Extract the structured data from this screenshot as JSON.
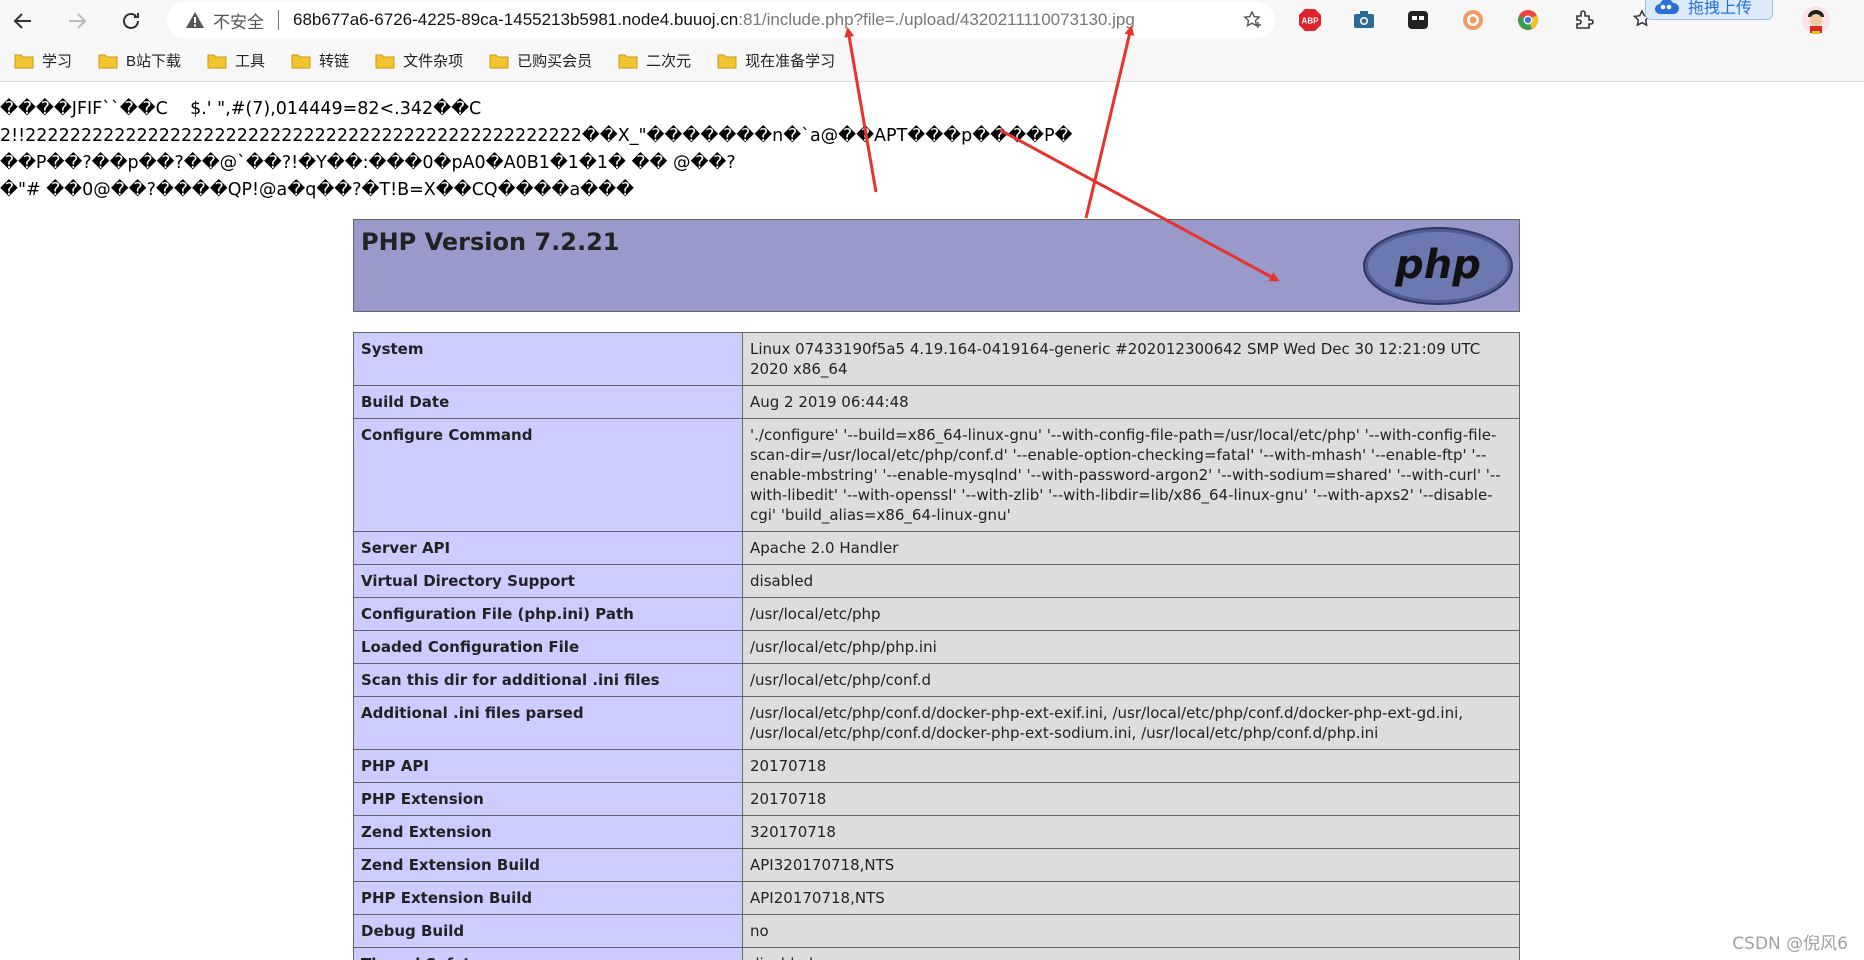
{
  "browser": {
    "security_label": "不安全",
    "url_host": "68b677a6-6726-4225-89ca-1455213b5981.node4.buuoj.cn",
    "url_rest": ":81/include.php?file=./upload/4320211110073130.jpg",
    "upload_chip_label": "拖拽上传",
    "icons": [
      "back-icon",
      "forward-icon",
      "reload-icon",
      "warning-icon",
      "favorite-icon",
      "abp-icon",
      "camera-icon",
      "extension-icon",
      "extension-icon",
      "extension-icon",
      "puzzle-icon",
      "favorites-icon",
      "avatar-icon"
    ]
  },
  "bookmarks": [
    {
      "label": "学习"
    },
    {
      "label": "B站下载"
    },
    {
      "label": "工具"
    },
    {
      "label": "转链"
    },
    {
      "label": "文件杂项"
    },
    {
      "label": "已购买会员"
    },
    {
      "label": "二次元"
    },
    {
      "label": "现在准备学习"
    }
  ],
  "garbage_lines": [
    "����\u0010JFIF\u0001\u0001\u0001``��C\u0002\u0002\u0002\u0002\u0002\u0002\u0002\u0002\u0002\u0002\u0002\u0002\u0002\u0002\u0002 \u0002 \u0002\u0002 \u0002\u0002\u0002\u0002\u0002\u0002\u0002\u0002\u0002\u0002\u0002\u0002\u0002\u0002\u0002\u0002\u0002\u0002 $.' \",#\u0001\u0001(7),01444\u00019=82<.342��C\u0001 \u0002\u0002\u0002\u0002\u0002",
    "\u00012!\u0001!22222222222222222222222222222222222222222222222222��\u0001\u0001X_\u0001\u0001\"\u0001\u0001\u0001\u0001\u0001\u0001\u0001��\u0001\u0001\u0001\u0001\u0001\u0001\u0001��\u0001\u0001\u0001\u0001\u0001\u0001\u0001\u0001\u0001\u0001\u0001\u0001��\u0001\u0001\u0001\u0001\u0001\u0001\u0001\u0001\u0001\u0001\u0001�n�`\u0001a@��APT�\u0001\u0001\u0001\u0001��\u0001\u0001\u0001\u0001p��\u0001\u0001\u0001\u0001\u0001\u0001\u0001\u0001\u0001\u0001��\u0001\u0001\u0001\u0001P�",
    "��\u0001\u0001\u0001\u0001P��\u0001\u0001\u0001\u0001\u0001\u0001?\u0001\u0001��\u0001\u0001\u0001\u0001\u0001p��\u0001\u0001\u0001\u0001\u0001?\u0001\u0001��\u0001\u0001\u0001\u0001\u0001\u0001\u0001\u0001@`��\u0001\u0001\u0001\u0001\u0001?!�Y��:���\u0001\u0001\u0001\u0001\u0001\u0001\u0001\u00010�\u0001pA\u00010�\u0001\u0001A\u00010B\u00011�1�1�\u0001\u0001 ��\u0001\u0001\u0001\u0001\u0001\u0001\u0001\u0001 @��\u0001\u0001\u0001\u0001\u0001\u0001?\u0001",
    "�\"# ��\u0001\u0001\u0001\u0001\u0001\u00010@��\u0001\u0001\u0001\u0001\u0001\u0001?\u0001����\u0001\u0001\u0001\u0001\u0001\u0001\u0001\u0001\u0001\u0001\u0001\u0001\u0001\u0001QP\u0001!@a�q��\u0001\u0001\u0001\u0001\u0001?\u0001�\u0001\u0001\u0001\u0001T!\u0001B=\u0001X��CQ��\u0001��a���"
  ],
  "phpinfo": {
    "version_title": "PHP Version 7.2.21",
    "logo_text": "php",
    "rows": [
      {
        "key": "System",
        "value": "Linux 07433190f5a5 4.19.164-0419164-generic #202012300642 SMP Wed Dec 30 12:21:09 UTC 2020 x86_64"
      },
      {
        "key": "Build Date",
        "value": "Aug 2 2019 06:44:48"
      },
      {
        "key": "Configure Command",
        "value": "'./configure' '--build=x86_64-linux-gnu' '--with-config-file-path=/usr/local/etc/php' '--with-config-file-scan-dir=/usr/local/etc/php/conf.d' '--enable-option-checking=fatal' '--with-mhash' '--enable-ftp' '--enable-mbstring' '--enable-mysqlnd' '--with-password-argon2' '--with-sodium=shared' '--with-curl' '--with-libedit' '--with-openssl' '--with-zlib' '--with-libdir=lib/x86_64-linux-gnu' '--with-apxs2' '--disable-cgi' 'build_alias=x86_64-linux-gnu'"
      },
      {
        "key": "Server API",
        "value": "Apache 2.0 Handler"
      },
      {
        "key": "Virtual Directory Support",
        "value": "disabled"
      },
      {
        "key": "Configuration File (php.ini) Path",
        "value": "/usr/local/etc/php"
      },
      {
        "key": "Loaded Configuration File",
        "value": "/usr/local/etc/php/php.ini"
      },
      {
        "key": "Scan this dir for additional .ini files",
        "value": "/usr/local/etc/php/conf.d"
      },
      {
        "key": "Additional .ini files parsed",
        "value": "/usr/local/etc/php/conf.d/docker-php-ext-exif.ini, /usr/local/etc/php/conf.d/docker-php-ext-gd.ini, /usr/local/etc/php/conf.d/docker-php-ext-sodium.ini, /usr/local/etc/php/conf.d/php.ini"
      },
      {
        "key": "PHP API",
        "value": "20170718"
      },
      {
        "key": "PHP Extension",
        "value": "20170718"
      },
      {
        "key": "Zend Extension",
        "value": "320170718"
      },
      {
        "key": "Zend Extension Build",
        "value": "API320170718,NTS"
      },
      {
        "key": "PHP Extension Build",
        "value": "API20170718,NTS"
      },
      {
        "key": "Debug Build",
        "value": "no"
      },
      {
        "key": "Thread Safety",
        "value": "disabled"
      }
    ]
  },
  "watermark": "CSDN @倪风6",
  "colors": {
    "php_header_bg": "#9999cc",
    "php_key_bg": "#ccccff",
    "php_value_bg": "#dddddd",
    "annotation_arrow": "#e8322b"
  }
}
